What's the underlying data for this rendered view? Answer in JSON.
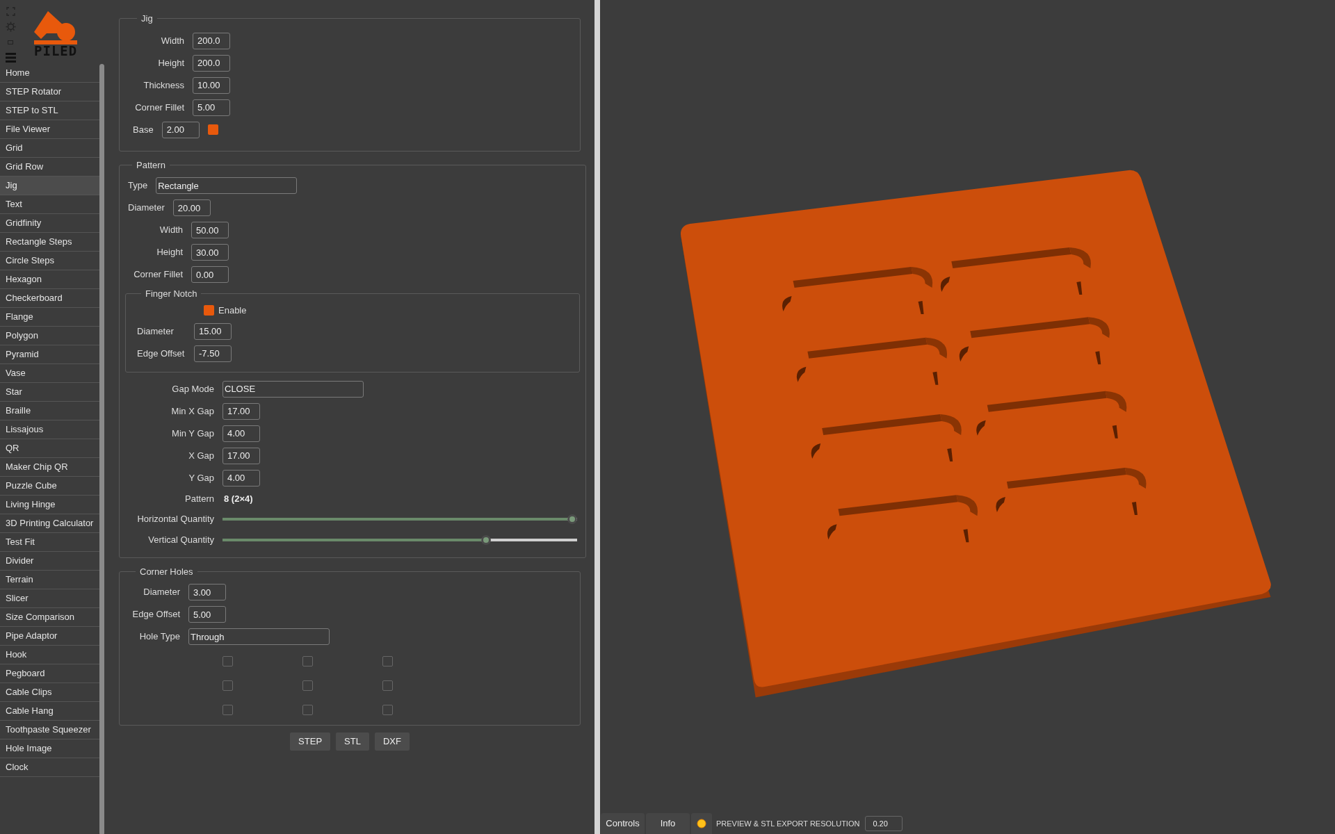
{
  "logo": {
    "text": "PILED"
  },
  "sidebar": {
    "items": [
      {
        "label": "Home",
        "selected": false
      },
      {
        "label": "STEP Rotator",
        "selected": false
      },
      {
        "label": "STEP to STL",
        "selected": false
      },
      {
        "label": "File Viewer",
        "selected": false
      },
      {
        "label": "Grid",
        "selected": false
      },
      {
        "label": "Grid Row",
        "selected": false
      },
      {
        "label": "Jig",
        "selected": true
      },
      {
        "label": "Text",
        "selected": false
      },
      {
        "label": "Gridfinity",
        "selected": false
      },
      {
        "label": "Rectangle Steps",
        "selected": false
      },
      {
        "label": "Circle Steps",
        "selected": false
      },
      {
        "label": "Hexagon",
        "selected": false
      },
      {
        "label": "Checkerboard",
        "selected": false
      },
      {
        "label": "Flange",
        "selected": false
      },
      {
        "label": "Polygon",
        "selected": false
      },
      {
        "label": "Pyramid",
        "selected": false
      },
      {
        "label": "Vase",
        "selected": false
      },
      {
        "label": "Star",
        "selected": false
      },
      {
        "label": "Braille",
        "selected": false
      },
      {
        "label": "Lissajous",
        "selected": false
      },
      {
        "label": "QR",
        "selected": false
      },
      {
        "label": "Maker Chip QR",
        "selected": false
      },
      {
        "label": "Puzzle Cube",
        "selected": false
      },
      {
        "label": "Living Hinge",
        "selected": false
      },
      {
        "label": "3D Printing Calculator",
        "selected": false
      },
      {
        "label": "Test Fit",
        "selected": false
      },
      {
        "label": "Divider",
        "selected": false
      },
      {
        "label": "Terrain",
        "selected": false
      },
      {
        "label": "Slicer",
        "selected": false
      },
      {
        "label": "Size Comparison",
        "selected": false
      },
      {
        "label": "Pipe Adaptor",
        "selected": false
      },
      {
        "label": "Hook",
        "selected": false
      },
      {
        "label": "Pegboard",
        "selected": false
      },
      {
        "label": "Cable Clips",
        "selected": false
      },
      {
        "label": "Cable Hang",
        "selected": false
      },
      {
        "label": "Toothpaste Squeezer",
        "selected": false
      },
      {
        "label": "Hole Image",
        "selected": false
      },
      {
        "label": "Clock",
        "selected": false
      }
    ]
  },
  "jig": {
    "title": "Jig",
    "fields": [
      {
        "kind": "number",
        "label": "Width",
        "value": "200.0"
      },
      {
        "kind": "number",
        "label": "Height",
        "value": "200.0"
      },
      {
        "kind": "number",
        "label": "Thickness",
        "value": "10.00"
      },
      {
        "kind": "number",
        "label": "Corner Fillet",
        "value": "5.00"
      },
      {
        "kind": "color-number",
        "label": "Base",
        "value": "2.00",
        "color": "#e8590c"
      }
    ]
  },
  "pattern": {
    "title": "Pattern",
    "fields": [
      {
        "kind": "select",
        "label": "Type",
        "value": "Rectangle"
      },
      {
        "kind": "number-left",
        "label": "Diameter",
        "value": "20.00"
      },
      {
        "kind": "number",
        "label": "Width",
        "value": "50.00"
      },
      {
        "kind": "number",
        "label": "Height",
        "value": "30.00"
      },
      {
        "kind": "number",
        "label": "Corner Fillet",
        "value": "0.00"
      }
    ],
    "finger_notch": {
      "title": "Finger Notch",
      "enable": {
        "label": "Enable",
        "checked": true
      },
      "fields": [
        {
          "kind": "number",
          "label": "Diameter",
          "value": "15.00"
        },
        {
          "kind": "number",
          "label": "Edge Offset",
          "value": "-7.50"
        }
      ]
    },
    "gap_fields": [
      {
        "kind": "select",
        "label": "Gap Mode",
        "value": "CLOSE"
      },
      {
        "kind": "number",
        "label": "Min X Gap",
        "value": "17.00"
      },
      {
        "kind": "number",
        "label": "Min Y Gap",
        "value": "4.00"
      },
      {
        "kind": "number",
        "label": "X Gap",
        "value": "17.00"
      },
      {
        "kind": "number",
        "label": "Y Gap",
        "value": "4.00"
      },
      {
        "kind": "text",
        "label": "Pattern",
        "value": "8 (2×4)"
      },
      {
        "kind": "slider",
        "label": "Horizontal Quantity",
        "level": 1
      },
      {
        "kind": "slider",
        "label": "Vertical Quantity",
        "level": 0.75
      }
    ]
  },
  "corner_holes": {
    "title": "Corner Holes",
    "fields": [
      {
        "kind": "number",
        "label": "Diameter",
        "value": "3.00"
      },
      {
        "kind": "number",
        "label": "Edge Offset",
        "value": "5.00"
      },
      {
        "kind": "select",
        "label": "Hole Type",
        "value": "Through"
      }
    ],
    "holes": [
      {
        "checked": false
      },
      {
        "checked": false
      },
      {
        "checked": false
      },
      {
        "checked": false
      },
      {
        "checked": false
      },
      {
        "checked": false
      },
      {
        "checked": false
      },
      {
        "checked": false
      },
      {
        "checked": false
      }
    ]
  },
  "export_buttons": [
    "STEP",
    "STL",
    "DXF"
  ],
  "bottom_bar": {
    "tabs": [
      "Controls",
      "Info"
    ],
    "resolution_label": "PREVIEW & STL EXPORT RESOLUTION",
    "resolution_value": "0.20"
  }
}
